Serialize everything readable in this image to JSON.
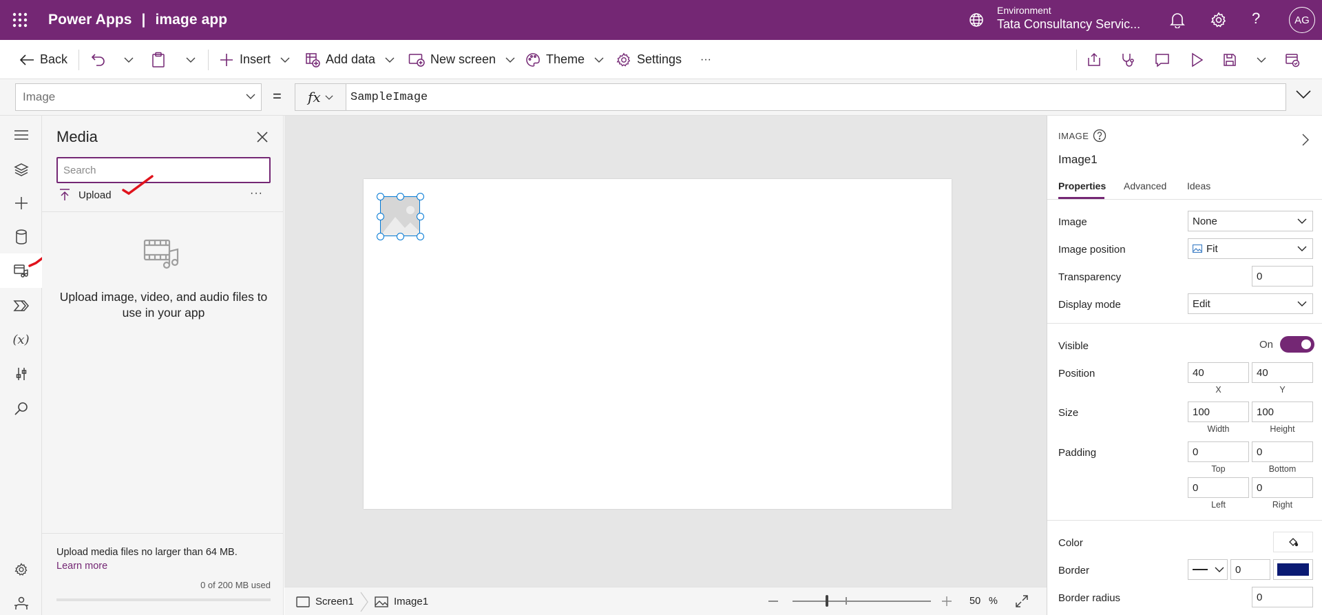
{
  "titlebar": {
    "product": "Power Apps",
    "separator": "|",
    "app_name": "image app",
    "environment_label": "Environment",
    "environment_name": "Tata Consultancy Servic...",
    "user_initials": "AG"
  },
  "commandbar": {
    "back": "Back",
    "insert": "Insert",
    "add_data": "Add data",
    "new_screen": "New screen",
    "theme": "Theme",
    "settings": "Settings",
    "more": "···"
  },
  "formulabar": {
    "property": "Image",
    "equals": "=",
    "fx": "fx",
    "formula": "SampleImage"
  },
  "media_panel": {
    "title": "Media",
    "search_placeholder": "Search",
    "upload": "Upload",
    "more": "···",
    "empty_message": "Upload image, video, and audio files to use in your app",
    "limit_note": "Upload media files no larger than 64 MB.",
    "learn_more": "Learn more",
    "usage": "0 of 200 MB used",
    "usage_fraction": 0
  },
  "statusbar": {
    "screen": "Screen1",
    "control": "Image1",
    "zoom": "50",
    "zoom_unit": "%",
    "zoom_fraction": 0.25
  },
  "properties": {
    "type_label": "IMAGE",
    "control_name": "Image1",
    "tabs": [
      "Properties",
      "Advanced",
      "Ideas"
    ],
    "image_label": "Image",
    "image_value": "None",
    "image_position_label": "Image position",
    "image_position_value": "Fit",
    "transparency_label": "Transparency",
    "transparency_value": "0",
    "display_mode_label": "Display mode",
    "display_mode_value": "Edit",
    "visible_label": "Visible",
    "visible_state": "On",
    "position_label": "Position",
    "position_x": "40",
    "position_y": "40",
    "x_label": "X",
    "y_label": "Y",
    "size_label": "Size",
    "size_width": "100",
    "size_height": "100",
    "width_label": "Width",
    "height_label": "Height",
    "padding_label": "Padding",
    "padding_top": "0",
    "padding_bottom": "0",
    "padding_left": "0",
    "padding_right": "0",
    "top_label": "Top",
    "bottom_label": "Bottom",
    "left_label": "Left",
    "right_label": "Right",
    "color_label": "Color",
    "border_label": "Border",
    "border_thickness": "0",
    "border_color": "#0a1a73",
    "border_radius_label": "Border radius",
    "border_radius_value": "0"
  },
  "colors": {
    "brand": "#742774",
    "selection": "#0078d4"
  }
}
